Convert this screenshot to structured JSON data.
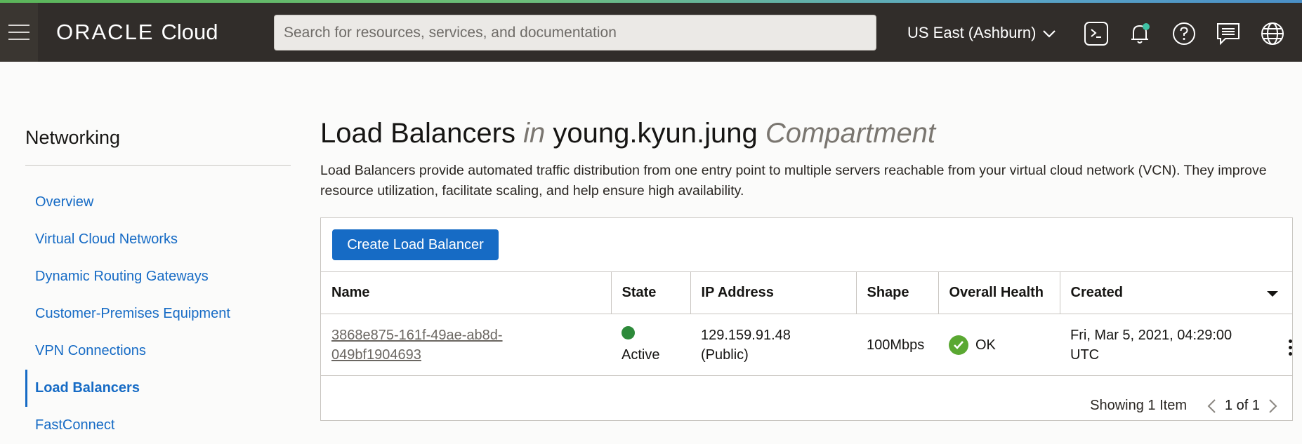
{
  "header": {
    "brand_oracle": "ORACLE",
    "brand_cloud": "Cloud",
    "search_placeholder": "Search for resources, services, and documentation",
    "region": "US East (Ashburn)"
  },
  "sidebar": {
    "title": "Networking",
    "items": [
      {
        "label": "Overview"
      },
      {
        "label": "Virtual Cloud Networks"
      },
      {
        "label": "Dynamic Routing Gateways"
      },
      {
        "label": "Customer-Premises Equipment"
      },
      {
        "label": "VPN Connections"
      },
      {
        "label": "Load Balancers"
      },
      {
        "label": "FastConnect"
      }
    ]
  },
  "main": {
    "title_part1": "Load Balancers",
    "title_in": "in",
    "title_compartment_name": "young.kyun.jung",
    "title_compartment": "Compartment",
    "description": "Load Balancers provide automated traffic distribution from one entry point to multiple servers reachable from your virtual cloud network (VCN). They improve resource utilization, facilitate scaling, and help ensure high availability.",
    "create_button": "Create Load Balancer",
    "columns": [
      "Name",
      "State",
      "IP Address",
      "Shape",
      "Overall Health",
      "Created"
    ],
    "rows": [
      {
        "name_line1": "3868e875-161f-49ae-ab8d-",
        "name_line2": "049bf1904693",
        "state": "Active",
        "ip_line1": "129.159.91.48",
        "ip_line2": "(Public)",
        "shape": "100Mbps",
        "health": "OK",
        "created_line1": "Fri, Mar 5, 2021, 04:29:00",
        "created_line2": "UTC"
      }
    ],
    "showing": "Showing 1 Item",
    "page": "1 of 1"
  },
  "colors": {
    "accent": "#166bc5",
    "header_bg": "#312d2a",
    "active_state": "#2d8a3a",
    "ok": "#5aa832"
  }
}
